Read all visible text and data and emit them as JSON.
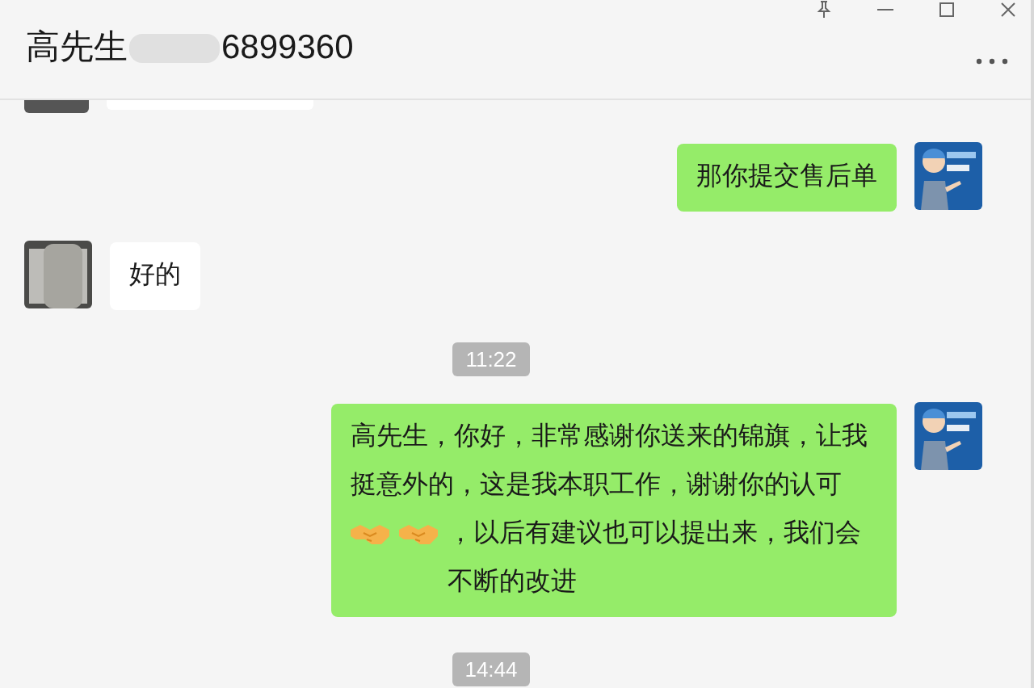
{
  "window": {
    "title_prefix": "高先生",
    "title_suffix": "6899360",
    "title_blurred": true
  },
  "messages": [
    {
      "kind": "cut",
      "outgoing": false
    },
    {
      "kind": "text",
      "outgoing": true,
      "segments": [
        {
          "kind": "text",
          "text": "那你提交售后单"
        }
      ]
    },
    {
      "kind": "text",
      "outgoing": false,
      "segments": [
        {
          "kind": "text",
          "text": "好的"
        }
      ]
    },
    {
      "kind": "time",
      "text": "11:22"
    },
    {
      "kind": "text",
      "outgoing": true,
      "segments": [
        {
          "kind": "text",
          "text": "高先生，你好，非常感谢你送来的锦旗，让我挺意外的，这是我本职工作，谢谢你的认可"
        },
        {
          "kind": "emoji"
        },
        {
          "kind": "emoji"
        },
        {
          "kind": "text",
          "text": "，以后有建议也可以提出来，我们会不断的改进"
        }
      ]
    },
    {
      "kind": "time",
      "text": "14:44"
    }
  ]
}
